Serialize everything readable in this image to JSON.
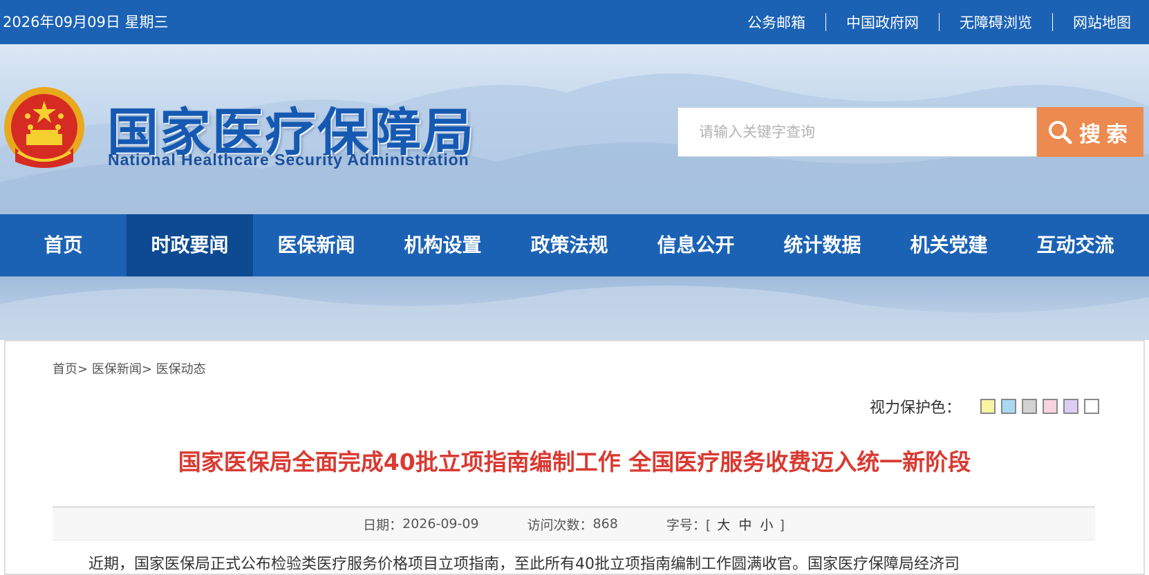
{
  "topbar": {
    "date": "2026年09月09日 星期三",
    "links": [
      "公务邮箱",
      "中国政府网",
      "无障碍浏览",
      "网站地图"
    ]
  },
  "header": {
    "title": "国家医疗保障局",
    "subtitle": "National Healthcare Security Administration",
    "emblem_icon": "national-emblem-icon"
  },
  "search": {
    "placeholder": "请输入关键字查询",
    "value": "",
    "button_label": "搜索",
    "icon": "search-icon"
  },
  "nav": {
    "items": [
      "首页",
      "时政要闻",
      "医保新闻",
      "机构设置",
      "政策法规",
      "信息公开",
      "统计数据",
      "机关党建",
      "互动交流"
    ],
    "active": "时政要闻"
  },
  "breadcrumb": [
    "首页>",
    "医保新闻>",
    "医保动态"
  ],
  "vision": {
    "label": "视力保护色：",
    "colors": [
      "#f9f3a4",
      "#a9d9f0",
      "#d2d2d2",
      "#f6d3de",
      "#dccdf3",
      "#ffffff"
    ]
  },
  "article": {
    "title": "国家医保局全面完成40批立项指南编制工作 全国医疗服务收费迈入统一新阶段",
    "date_label": "日期：",
    "date": "2026-09-09",
    "visits_label": "访问次数：",
    "visits": "868",
    "font_label": "字号：",
    "font_open": "[",
    "font_sizes": [
      "大",
      "中",
      "小"
    ],
    "font_close": "]",
    "body_first_line": "近期，国家医保局正式公布检验类医疗服务价格项目立项指南，至此所有40批立项指南编制工作圆满收官。国家医疗保障局经济司"
  },
  "colors": {
    "primary_blue": "#1b62b5",
    "nav_active": "#0d4a92",
    "search_orange": "#ec8a4f",
    "title_red": "#d93a32"
  }
}
